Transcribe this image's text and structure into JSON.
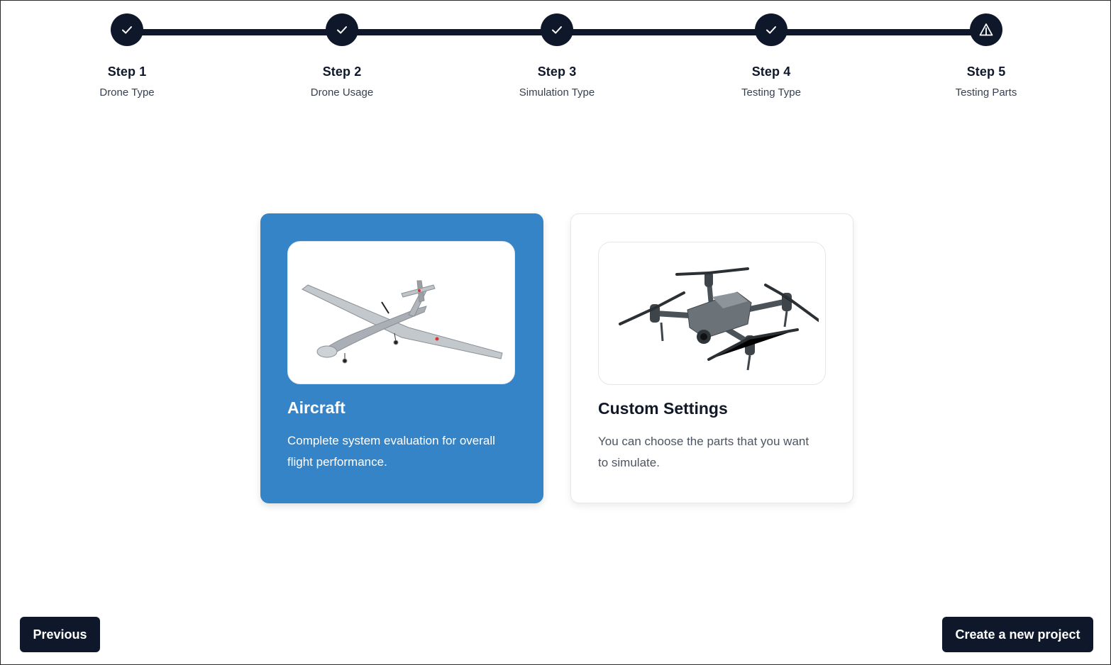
{
  "stepper": {
    "steps": [
      {
        "title": "Step 1",
        "subtitle": "Drone Type",
        "status": "complete",
        "icon": "check-icon"
      },
      {
        "title": "Step 2",
        "subtitle": "Drone Usage",
        "status": "complete",
        "icon": "check-icon"
      },
      {
        "title": "Step 3",
        "subtitle": "Simulation Type",
        "status": "complete",
        "icon": "check-icon"
      },
      {
        "title": "Step 4",
        "subtitle": "Testing Type",
        "status": "complete",
        "icon": "check-icon"
      },
      {
        "title": "Step 5",
        "subtitle": "Testing Parts",
        "status": "current",
        "icon": "warning-triangle-icon"
      }
    ]
  },
  "options": [
    {
      "title": "Aircraft",
      "description": "Complete system evaluation for overall flight performance.",
      "selected": true,
      "image": "fixed-wing-drone-image"
    },
    {
      "title": "Custom Settings",
      "description": "You can choose the parts that you want to simulate.",
      "selected": false,
      "image": "quadcopter-drone-image"
    }
  ],
  "footer": {
    "previous_label": "Previous",
    "create_label": "Create a new project"
  },
  "colors": {
    "dark": "#0f172a",
    "selected_card": "#3584c7"
  }
}
